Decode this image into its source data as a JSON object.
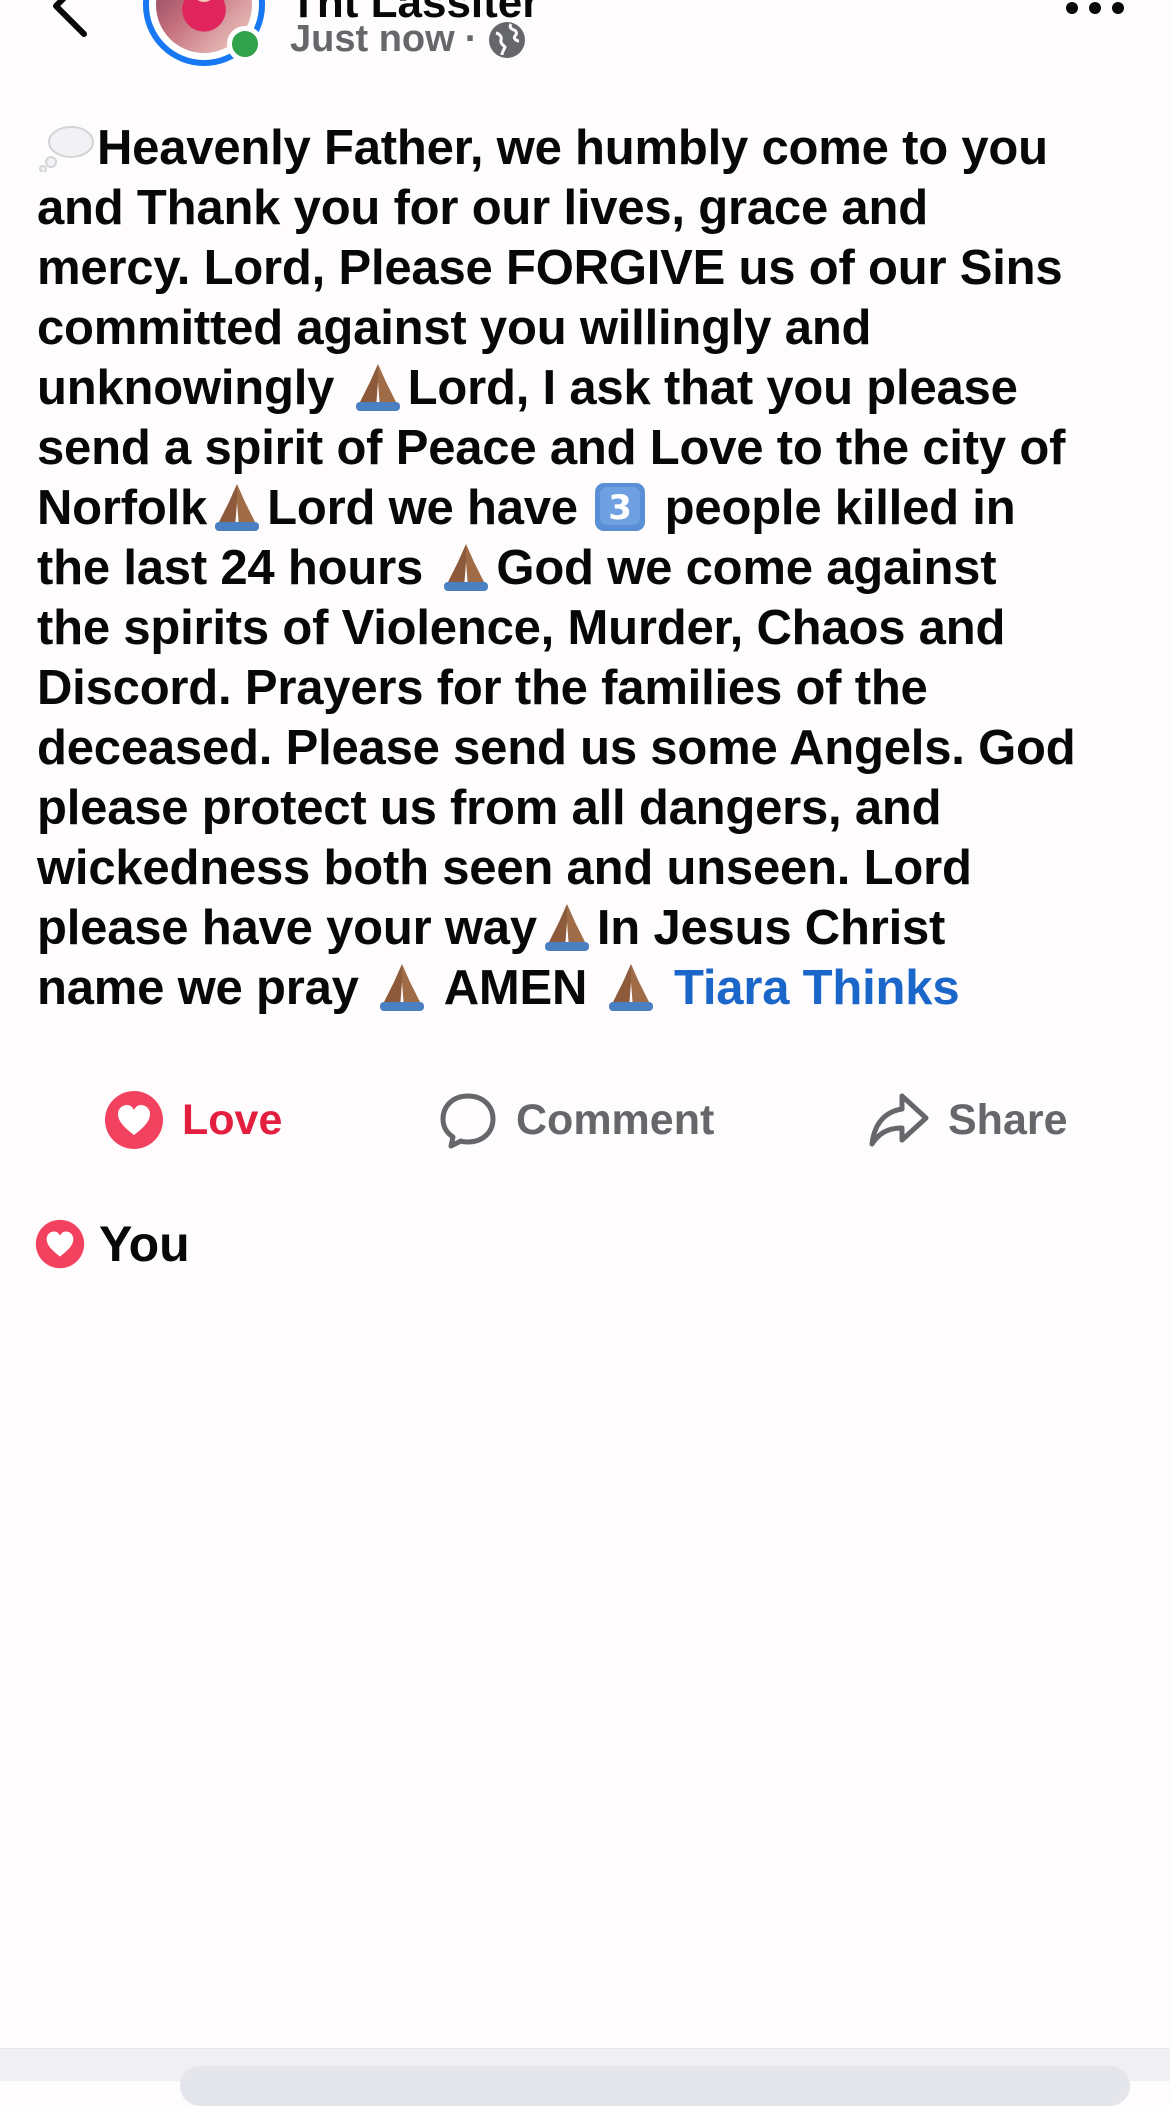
{
  "header": {
    "author_name": "Tnt Lassiter",
    "timestamp": "Just now",
    "separator": "·",
    "privacy_icon": "globe-icon",
    "back_icon": "chevron-left-icon",
    "more_icon": "more-dots-icon"
  },
  "post": {
    "lines": [
      "Heavenly Father, we humbly come to you",
      "and Thank you for our lives, grace and",
      "mercy. Lord, Please FORGIVE us of our Sins",
      "committed against you willingly and",
      "unknowingly ",
      "Lord, I ask that you please",
      "send a spirit of Peace and Love to the city of",
      "Norfolk",
      "Lord we have ",
      " people killed in",
      "the last 24 hours ",
      "God we come against",
      "the spirits of Violence, Murder, Chaos and",
      "Discord. Prayers for the families of the",
      "deceased. Please send us some Angels. God",
      "please protect us from all dangers, and",
      "wickedness both seen and unseen. Lord",
      "please have your way",
      "In Jesus Christ",
      "name we pray ",
      " AMEN ",
      " "
    ],
    "link_text": "Tiara Thinks"
  },
  "actions": {
    "love_label": "Love",
    "comment_label": "Comment",
    "share_label": "Share"
  },
  "reactions": {
    "summary": "You"
  },
  "colors": {
    "accent_blue": "#1877f2",
    "link_blue": "#1b66c9",
    "love_red": "#e41e3f",
    "muted_gray": "#65676b",
    "online_green": "#31a24c"
  }
}
